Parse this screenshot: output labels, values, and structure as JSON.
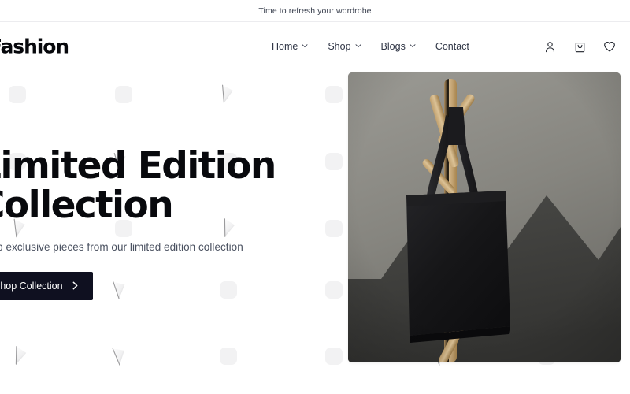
{
  "announcement": {
    "text": "Time to refresh your wordrobe"
  },
  "header": {
    "logo": "Fashion",
    "nav": [
      {
        "label": "Home",
        "has_dropdown": true,
        "icon": "chevron-down-icon"
      },
      {
        "label": "Shop",
        "has_dropdown": true,
        "icon": "chevron-down-icon"
      },
      {
        "label": "Blogs",
        "has_dropdown": true,
        "icon": "chevron-down-icon"
      },
      {
        "label": "Contact",
        "has_dropdown": false,
        "icon": ""
      }
    ],
    "actions": [
      {
        "name": "account-icon",
        "label": "Account"
      },
      {
        "name": "bag-icon",
        "label": "Cart"
      },
      {
        "name": "heart-icon",
        "label": "Wishlist"
      }
    ]
  },
  "hero": {
    "title": "Limited Edition\nCollection",
    "subtitle": "Shop exclusive pieces from our limited edition collection",
    "cta_label": "Shop Collection",
    "cta_icon": "chevron-right-icon",
    "image_alt": "Black canvas tote bag hanging on a wooden coat rack"
  },
  "colors": {
    "cta_background": "#0f1020",
    "cta_text": "#ffffff",
    "heading": "#08090d",
    "body_text": "#4a5160",
    "announce_text": "#3c4250",
    "page_background": "#ffffff",
    "pattern_shape": "#f2f2f3",
    "image_wall_light": "#8b8a85",
    "image_wall_dark": "#3f3f3d",
    "image_bag": "#151517",
    "image_wood": "#c8a97a"
  }
}
